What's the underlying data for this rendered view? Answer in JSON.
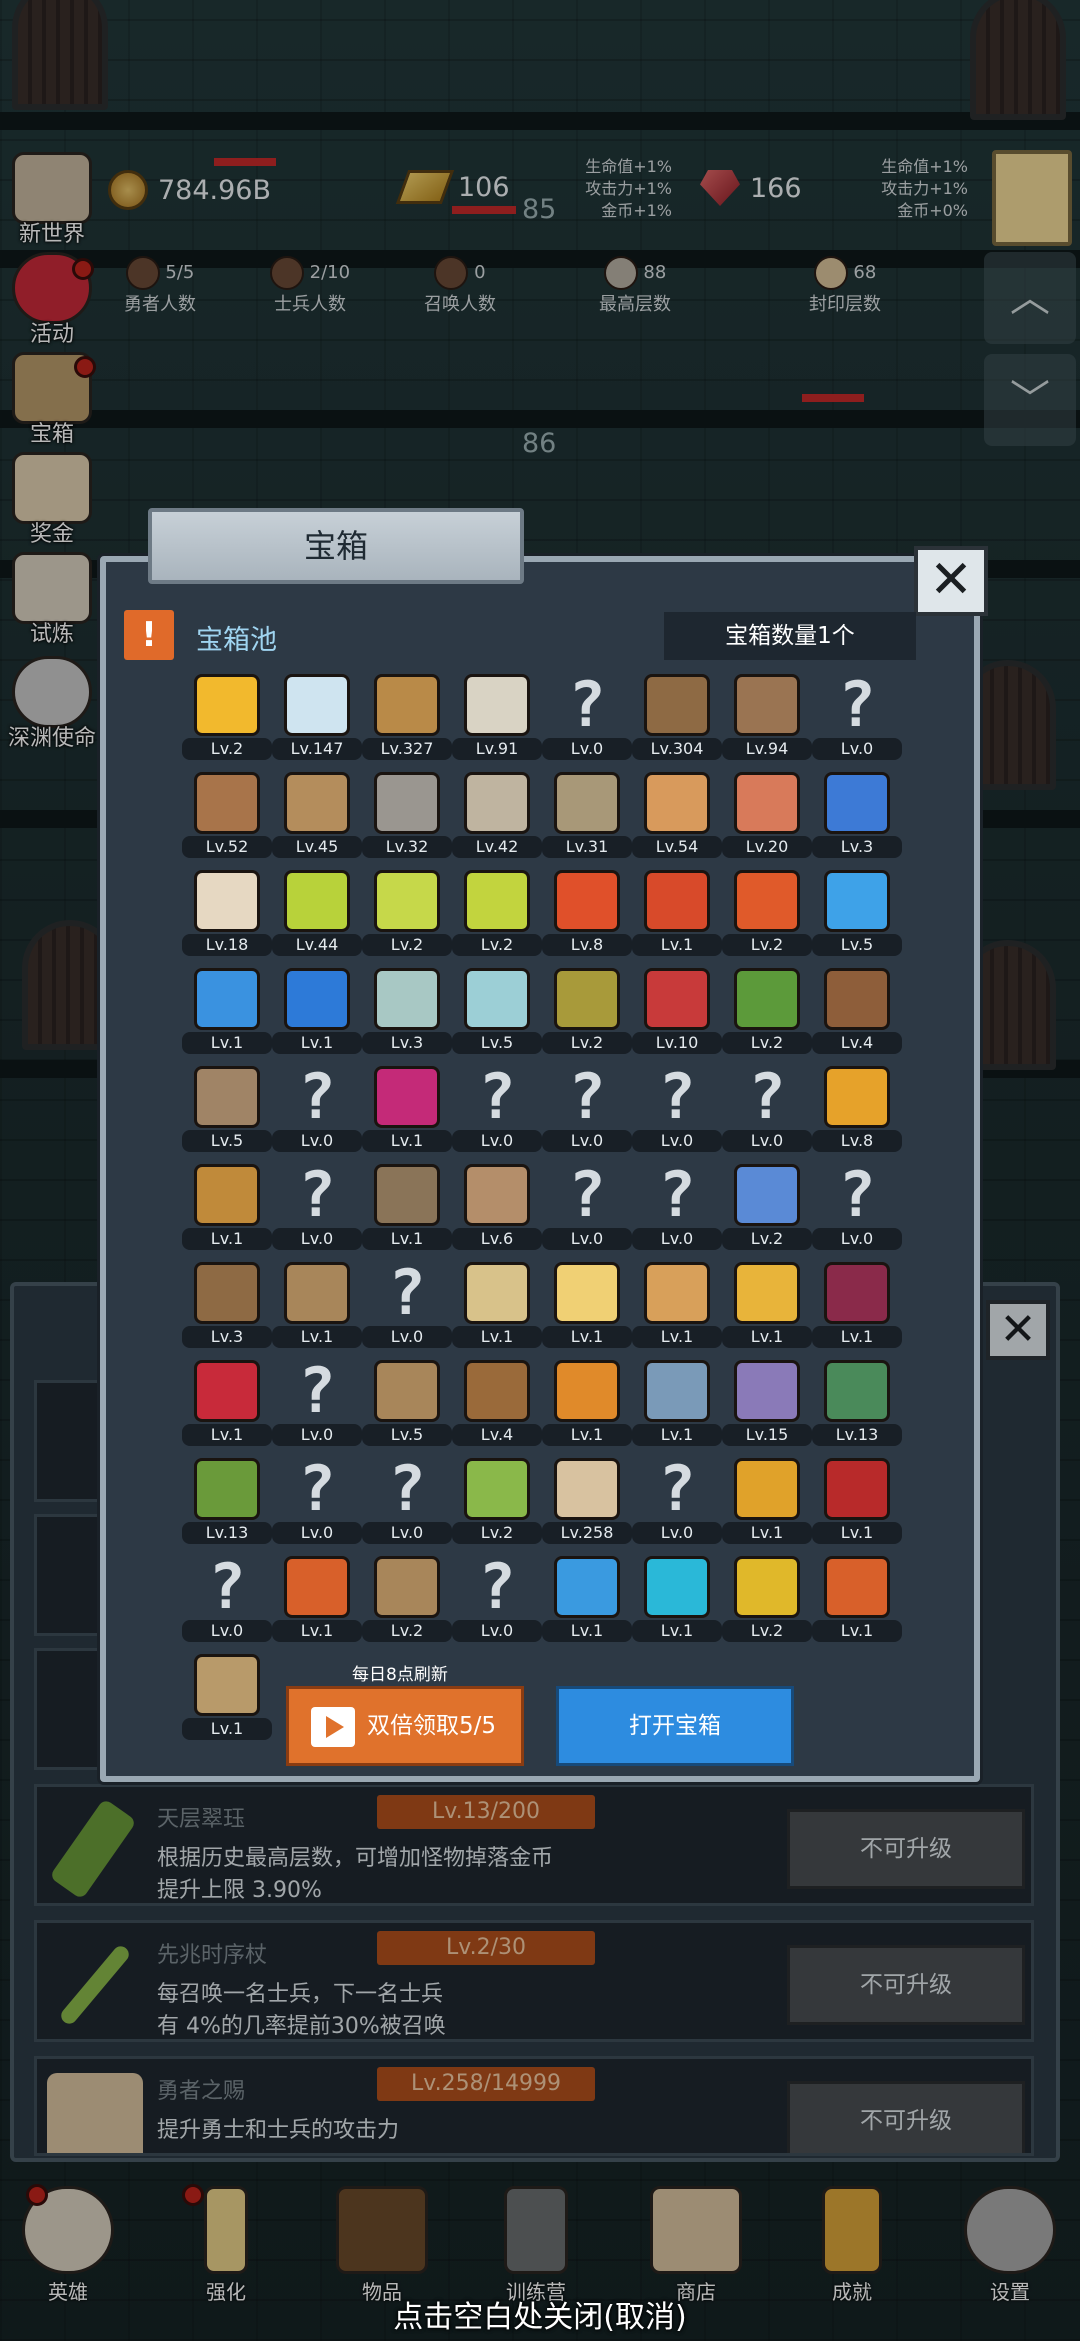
{
  "hud": {
    "gold": "784.96B",
    "bars": "106",
    "gems": "166",
    "bonus_left": [
      "生命值+1%",
      "攻击力+1%",
      "金币+1%"
    ],
    "bonus_right": [
      "生命值+1%",
      "攻击力+1%",
      "金币+0%"
    ],
    "floor_a": "85",
    "floor_b": "86",
    "stats": [
      {
        "value": "5/5",
        "label": "勇者人数"
      },
      {
        "value": "2/10",
        "label": "士兵人数"
      },
      {
        "value": "0",
        "label": "召唤人数"
      },
      {
        "value": "88",
        "label": "最高层数"
      },
      {
        "value": "68",
        "label": "封印层数"
      }
    ]
  },
  "side_menu": [
    "新世界",
    "活动",
    "宝箱",
    "奖金",
    "试炼",
    "深渊使命"
  ],
  "modal": {
    "title": "宝箱",
    "close": "✕",
    "pool_label": "宝箱池",
    "count_label": "宝箱数量1个",
    "refresh_note": "每日8点刷新",
    "double_btn": "双倍领取5/5",
    "open_btn": "打开宝箱",
    "items": [
      {
        "lv": "Lv.2",
        "c": "#f2b92d",
        "u": false
      },
      {
        "lv": "Lv.147",
        "c": "#cfe4f0",
        "u": false
      },
      {
        "lv": "Lv.327",
        "c": "#b98a48",
        "u": false
      },
      {
        "lv": "Lv.91",
        "c": "#d9d3c4",
        "u": false
      },
      {
        "lv": "Lv.0",
        "c": "",
        "u": true
      },
      {
        "lv": "Lv.304",
        "c": "#8e6a44",
        "u": false
      },
      {
        "lv": "Lv.94",
        "c": "#9a7452",
        "u": false
      },
      {
        "lv": "Lv.0",
        "c": "",
        "u": true
      },
      {
        "lv": "Lv.52",
        "c": "#a8744a",
        "u": false
      },
      {
        "lv": "Lv.45",
        "c": "#b48d5c",
        "u": false
      },
      {
        "lv": "Lv.32",
        "c": "#9a9690",
        "u": false
      },
      {
        "lv": "Lv.42",
        "c": "#bfb4a0",
        "u": false
      },
      {
        "lv": "Lv.31",
        "c": "#a89878",
        "u": false
      },
      {
        "lv": "Lv.54",
        "c": "#d89a5c",
        "u": false
      },
      {
        "lv": "Lv.20",
        "c": "#d87a5a",
        "u": false
      },
      {
        "lv": "Lv.3",
        "c": "#3d7ad6",
        "u": false
      },
      {
        "lv": "Lv.18",
        "c": "#e6d8c2",
        "u": false
      },
      {
        "lv": "Lv.44",
        "c": "#b8d23a",
        "u": false
      },
      {
        "lv": "Lv.2",
        "c": "#c6d84a",
        "u": false
      },
      {
        "lv": "Lv.2",
        "c": "#c2d43e",
        "u": false
      },
      {
        "lv": "Lv.8",
        "c": "#e0502a",
        "u": false
      },
      {
        "lv": "Lv.1",
        "c": "#d84a2a",
        "u": false
      },
      {
        "lv": "Lv.2",
        "c": "#e05a2a",
        "u": false
      },
      {
        "lv": "Lv.5",
        "c": "#3ea2e8",
        "u": false
      },
      {
        "lv": "Lv.1",
        "c": "#3a92e0",
        "u": false
      },
      {
        "lv": "Lv.1",
        "c": "#2d7ad8",
        "u": false
      },
      {
        "lv": "Lv.3",
        "c": "#a8c8c4",
        "u": false
      },
      {
        "lv": "Lv.5",
        "c": "#9ccfd6",
        "u": false
      },
      {
        "lv": "Lv.2",
        "c": "#a89a3a",
        "u": false
      },
      {
        "lv": "Lv.10",
        "c": "#c83a3a",
        "u": false
      },
      {
        "lv": "Lv.2",
        "c": "#5c9a3a",
        "u": false
      },
      {
        "lv": "Lv.4",
        "c": "#8e5e3a",
        "u": false
      },
      {
        "lv": "Lv.5",
        "c": "#a08466",
        "u": false
      },
      {
        "lv": "Lv.0",
        "c": "",
        "u": true
      },
      {
        "lv": "Lv.1",
        "c": "#c42a78",
        "u": false
      },
      {
        "lv": "Lv.0",
        "c": "",
        "u": true
      },
      {
        "lv": "Lv.0",
        "c": "",
        "u": true
      },
      {
        "lv": "Lv.0",
        "c": "",
        "u": true
      },
      {
        "lv": "Lv.0",
        "c": "",
        "u": true
      },
      {
        "lv": "Lv.8",
        "c": "#e6a22a",
        "u": false
      },
      {
        "lv": "Lv.1",
        "c": "#c08a3a",
        "u": false
      },
      {
        "lv": "Lv.0",
        "c": "",
        "u": true
      },
      {
        "lv": "Lv.1",
        "c": "#8a7458",
        "u": false
      },
      {
        "lv": "Lv.6",
        "c": "#b48e6a",
        "u": false
      },
      {
        "lv": "Lv.0",
        "c": "",
        "u": true
      },
      {
        "lv": "Lv.0",
        "c": "",
        "u": true
      },
      {
        "lv": "Lv.2",
        "c": "#5a8ad6",
        "u": false
      },
      {
        "lv": "Lv.0",
        "c": "",
        "u": true
      },
      {
        "lv": "Lv.3",
        "c": "#8e6a44",
        "u": false
      },
      {
        "lv": "Lv.1",
        "c": "#a8865a",
        "u": false
      },
      {
        "lv": "Lv.0",
        "c": "",
        "u": true
      },
      {
        "lv": "Lv.1",
        "c": "#d8c28a",
        "u": false
      },
      {
        "lv": "Lv.1",
        "c": "#f0d074",
        "u": false
      },
      {
        "lv": "Lv.1",
        "c": "#d8a05a",
        "u": false
      },
      {
        "lv": "Lv.1",
        "c": "#e8b43a",
        "u": false
      },
      {
        "lv": "Lv.1",
        "c": "#8a2a4a",
        "u": false
      },
      {
        "lv": "Lv.1",
        "c": "#c82a3a",
        "u": false
      },
      {
        "lv": "Lv.0",
        "c": "",
        "u": true
      },
      {
        "lv": "Lv.5",
        "c": "#a8865a",
        "u": false
      },
      {
        "lv": "Lv.4",
        "c": "#9a6a3a",
        "u": false
      },
      {
        "lv": "Lv.1",
        "c": "#e08a2a",
        "u": false
      },
      {
        "lv": "Lv.1",
        "c": "#7a9ab8",
        "u": false
      },
      {
        "lv": "Lv.15",
        "c": "#8a7ab8",
        "u": false
      },
      {
        "lv": "Lv.13",
        "c": "#4a8a5a",
        "u": false
      },
      {
        "lv": "Lv.13",
        "c": "#6a9a3a",
        "u": false
      },
      {
        "lv": "Lv.0",
        "c": "",
        "u": true
      },
      {
        "lv": "Lv.0",
        "c": "",
        "u": true
      },
      {
        "lv": "Lv.2",
        "c": "#8ab84a",
        "u": false
      },
      {
        "lv": "Lv.258",
        "c": "#d8c2a0",
        "u": false
      },
      {
        "lv": "Lv.0",
        "c": "",
        "u": true
      },
      {
        "lv": "Lv.1",
        "c": "#e0a22a",
        "u": false
      },
      {
        "lv": "Lv.1",
        "c": "#b82a2a",
        "u": false
      },
      {
        "lv": "Lv.0",
        "c": "",
        "u": true
      },
      {
        "lv": "Lv.1",
        "c": "#d8602a",
        "u": false
      },
      {
        "lv": "Lv.2",
        "c": "#a8865a",
        "u": false
      },
      {
        "lv": "Lv.0",
        "c": "",
        "u": true
      },
      {
        "lv": "Lv.1",
        "c": "#3a9ae0",
        "u": false
      },
      {
        "lv": "Lv.1",
        "c": "#2ab8d8",
        "u": false
      },
      {
        "lv": "Lv.2",
        "c": "#e0b82a",
        "u": false
      },
      {
        "lv": "Lv.1",
        "c": "#d8602a",
        "u": false
      },
      {
        "lv": "Lv.1",
        "c": "#b89a6a",
        "u": false
      }
    ]
  },
  "rows": [
    {
      "name": "天层翠珏",
      "lv": "Lv.13/200",
      "desc1": "根据历史最高层数，可增加怪物掉落金币",
      "desc2": "提升上限 3.90%",
      "btn": "不可升级",
      "color": "#6a9a3a"
    },
    {
      "name": "先兆时序杖",
      "lv": "Lv.2/30",
      "desc1": "每召唤一名士兵，下一名士兵",
      "desc2": "有 4%的几率提前30%被召唤",
      "btn": "不可升级",
      "color": "#8ab84a"
    },
    {
      "name": "勇者之赐",
      "lv": "Lv.258/14999",
      "desc1": "提升勇士和士兵的攻击力",
      "desc2": "",
      "btn": "不可升级",
      "color": "#d8c2a0"
    }
  ],
  "under_close": "✕",
  "scroll": {
    "up": "︿",
    "down": "﹀"
  },
  "nav": [
    "英雄",
    "强化",
    "物品",
    "训练营",
    "商店",
    "成就",
    "设置"
  ],
  "hint": "点击空白处关闭(取消)"
}
